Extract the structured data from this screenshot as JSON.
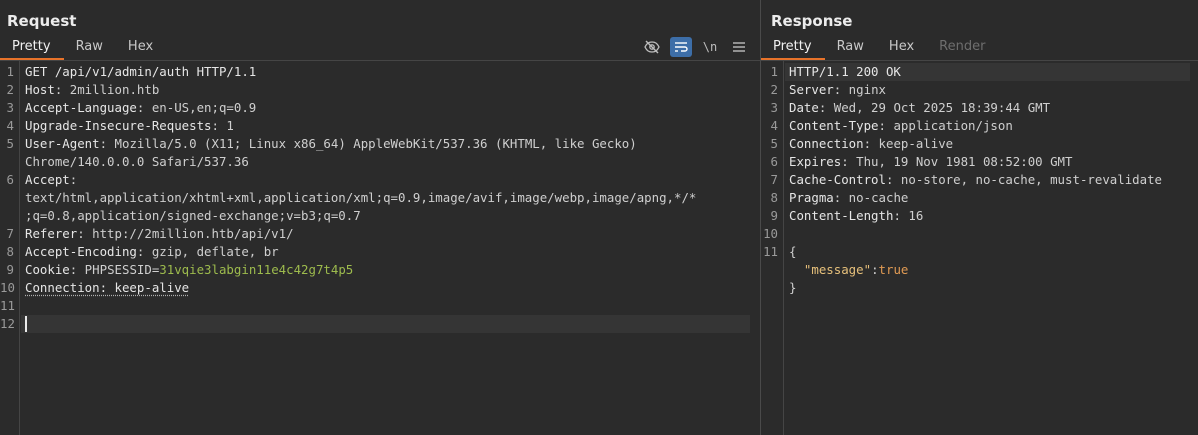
{
  "request": {
    "title": "Request",
    "tabs": [
      "Pretty",
      "Raw",
      "Hex"
    ],
    "active_tab": "Pretty",
    "tools": {
      "hide_icon": "eye-slash-icon",
      "wrap_icon": "word-wrap-icon",
      "newline_label": "\\n",
      "menu_icon": "hamburger-menu-icon"
    },
    "lines": [
      {
        "n": "1",
        "parts": [
          {
            "t": "GET /api/v1/admin/auth HTTP/1.1",
            "c": "hk"
          }
        ]
      },
      {
        "n": "2",
        "parts": [
          {
            "t": "Host",
            "c": "hk"
          },
          {
            "t": ": 2million.htb",
            "c": "hv"
          }
        ]
      },
      {
        "n": "3",
        "parts": [
          {
            "t": "Accept-Language",
            "c": "hk"
          },
          {
            "t": ": en-US,en;q=0.9",
            "c": "hv"
          }
        ]
      },
      {
        "n": "4",
        "parts": [
          {
            "t": "Upgrade-Insecure-Requests",
            "c": "hk"
          },
          {
            "t": ": 1",
            "c": "hv"
          }
        ]
      },
      {
        "n": "5",
        "parts": [
          {
            "t": "User-Agent",
            "c": "hk"
          },
          {
            "t": ": Mozilla/5.0 (X11; Linux x86_64) AppleWebKit/537.36 (KHTML, like Gecko)",
            "c": "hv"
          }
        ]
      },
      {
        "n": "",
        "parts": [
          {
            "t": "Chrome/140.0.0.0 Safari/537.36",
            "c": "hv"
          }
        ]
      },
      {
        "n": "6",
        "parts": [
          {
            "t": "Accept",
            "c": "hk"
          },
          {
            "t": ":",
            "c": "hv"
          }
        ]
      },
      {
        "n": "",
        "parts": [
          {
            "t": "text/html,application/xhtml+xml,application/xml;q=0.9,image/avif,image/webp,image/apng,*/*",
            "c": "hv"
          }
        ]
      },
      {
        "n": "",
        "parts": [
          {
            "t": ";q=0.8,application/signed-exchange;v=b3;q=0.7",
            "c": "hv"
          }
        ]
      },
      {
        "n": "7",
        "parts": [
          {
            "t": "Referer",
            "c": "hk"
          },
          {
            "t": ": http://2million.htb/api/v1/",
            "c": "hv"
          }
        ]
      },
      {
        "n": "8",
        "parts": [
          {
            "t": "Accept-Encoding",
            "c": "hk"
          },
          {
            "t": ": gzip, deflate, br",
            "c": "hv"
          }
        ]
      },
      {
        "n": "9",
        "parts": [
          {
            "t": "Cookie",
            "c": "hk"
          },
          {
            "t": ": PHPSESSID=",
            "c": "hv"
          },
          {
            "t": "31vqie3labgin11e4c42g7t4p5",
            "c": "cookie-val"
          }
        ]
      },
      {
        "n": "10",
        "parts": [
          {
            "t": "Connection: keep-alive",
            "c": "hk wavy"
          }
        ]
      },
      {
        "n": "11",
        "parts": []
      },
      {
        "n": "12",
        "parts": []
      }
    ]
  },
  "response": {
    "title": "Response",
    "tabs": [
      "Pretty",
      "Raw",
      "Hex",
      "Render"
    ],
    "active_tab": "Pretty",
    "disabled_tabs": [
      "Render"
    ],
    "lines": [
      {
        "n": "1",
        "parts": [
          {
            "t": "HTTP/1.1 200 OK",
            "c": "hk"
          }
        ]
      },
      {
        "n": "2",
        "parts": [
          {
            "t": "Server",
            "c": "hk"
          },
          {
            "t": ": nginx",
            "c": "hv"
          }
        ]
      },
      {
        "n": "3",
        "parts": [
          {
            "t": "Date",
            "c": "hk"
          },
          {
            "t": ": Wed, 29 Oct 2025 18:39:44 GMT",
            "c": "hv"
          }
        ]
      },
      {
        "n": "4",
        "parts": [
          {
            "t": "Content-Type",
            "c": "hk"
          },
          {
            "t": ": application/json",
            "c": "hv"
          }
        ]
      },
      {
        "n": "5",
        "parts": [
          {
            "t": "Connection",
            "c": "hk"
          },
          {
            "t": ": keep-alive",
            "c": "hv"
          }
        ]
      },
      {
        "n": "6",
        "parts": [
          {
            "t": "Expires",
            "c": "hk"
          },
          {
            "t": ": Thu, 19 Nov 1981 08:52:00 GMT",
            "c": "hv"
          }
        ]
      },
      {
        "n": "7",
        "parts": [
          {
            "t": "Cache-Control",
            "c": "hk"
          },
          {
            "t": ": no-store, no-cache, must-revalidate",
            "c": "hv"
          }
        ]
      },
      {
        "n": "8",
        "parts": [
          {
            "t": "Pragma",
            "c": "hk"
          },
          {
            "t": ": no-cache",
            "c": "hv"
          }
        ]
      },
      {
        "n": "9",
        "parts": [
          {
            "t": "Content-Length",
            "c": "hk"
          },
          {
            "t": ": 16",
            "c": "hv"
          }
        ]
      },
      {
        "n": "10",
        "parts": []
      },
      {
        "n": "11",
        "parts": [
          {
            "t": "{",
            "c": "hv"
          }
        ]
      },
      {
        "n": "",
        "parts": [
          {
            "t": "  ",
            "c": "hv"
          },
          {
            "t": "\"message\"",
            "c": "json-key"
          },
          {
            "t": ":",
            "c": "hv"
          },
          {
            "t": "true",
            "c": "json-bool"
          }
        ]
      },
      {
        "n": "",
        "parts": [
          {
            "t": "}",
            "c": "hv"
          }
        ]
      }
    ]
  },
  "colors": {
    "background": "#2b2b2b",
    "accent_tab_underline": "#e8732a",
    "toggle_on": "#3d6ea8",
    "cookie_value": "#9dbb4d",
    "json_key": "#e6c07b",
    "json_bool": "#e09a53"
  }
}
